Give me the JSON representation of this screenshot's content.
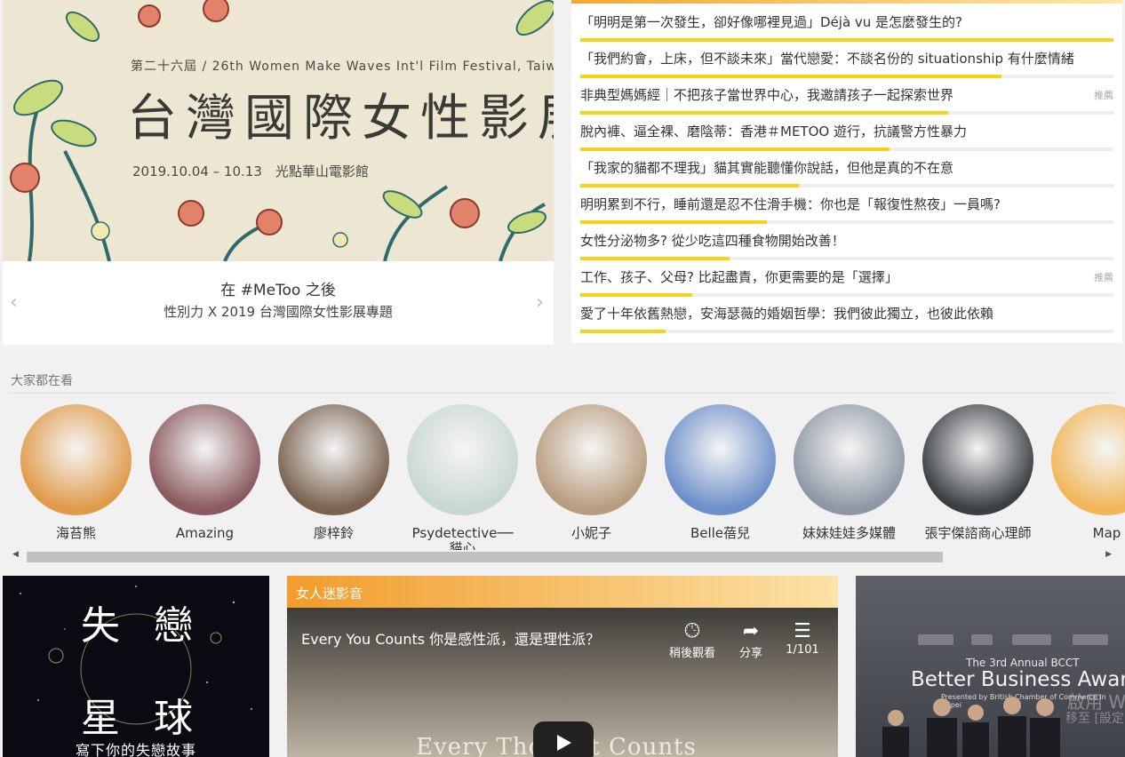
{
  "banner": {
    "subtitle": "第二十六屆 / 26th Women Make Waves Int'l Film Festival, Taiw",
    "title": "台灣國際女性影展",
    "date_venue": "2019.10.04 – 10.13　光點華山電影館",
    "caption_title": "在 #MeToo 之後",
    "caption_sub": "性別力 X 2019 台灣國際女性影展專題",
    "prev": "‹",
    "next": "›"
  },
  "articles": [
    {
      "title": "「明明是第一次發生，卻好像哪裡見過」Déjà vu 是怎麼發生的?",
      "tag": "",
      "progress": 1.0
    },
    {
      "title": "「我們約會，上床，但不談未來」當代戀愛：不談名份的 situationship 有什麼情緒",
      "tag": "",
      "progress": 0.79
    },
    {
      "title": "非典型媽媽經｜不把孩子當世界中心，我邀請孩子一起探索世界",
      "tag": "推薦",
      "progress": 0.69
    },
    {
      "title": "脫內褲、逼全裸、磨陰蒂：香港＃METOO 遊行，抗議警方性暴力",
      "tag": "",
      "progress": 0.58
    },
    {
      "title": "「我家的貓都不理我」貓其實能聽懂你說話，但他是真的不在意",
      "tag": "",
      "progress": 0.41
    },
    {
      "title": "明明累到不行，睡前還是忍不住滑手機：你也是「報復性熬夜」一員嗎?",
      "tag": "",
      "progress": 0.35
    },
    {
      "title": "女性分泌物多? 從少吃這四種食物開始改善！",
      "tag": "",
      "progress": 0.28
    },
    {
      "title": "工作、孩子、父母? 比起盡責，你更需要的是「選擇」",
      "tag": "推薦",
      "progress": 0.21
    },
    {
      "title": "愛了十年依舊熱戀，安海瑟薇的婚姻哲學：我們彼此獨立，也彼此依賴",
      "tag": "",
      "progress": 0.16
    }
  ],
  "everyone_watching": {
    "title": "大家都在看",
    "people": [
      {
        "name": "海苔熊",
        "color": "#e09a4a"
      },
      {
        "name": "Amazing",
        "color": "#8a5a5e"
      },
      {
        "name": "廖梓鈴",
        "color": "#7a6350"
      },
      {
        "name": "Psydetective──貓心",
        "color": "#c8d8d0"
      },
      {
        "name": "小妮子",
        "color": "#b89c7e"
      },
      {
        "name": "Belle蓓兒",
        "color": "#6d8fc9"
      },
      {
        "name": "妹妹娃娃多媒體",
        "color": "#8d98a5"
      },
      {
        "name": "張宇傑諮商心理師",
        "color": "#3a3f44"
      },
      {
        "name": "Map",
        "color": "#f1b65a"
      }
    ]
  },
  "cards": {
    "heartbreak": {
      "char1": "失",
      "char2": "戀",
      "char3": "星",
      "char4": "球",
      "cta": "寫下你的失戀故事"
    },
    "video": {
      "section": "女人迷影音",
      "title": "Every You Counts 你是感性派，還是理性派？",
      "watch_later": "稍後觀看",
      "share": "分享",
      "playlist": "1/101",
      "overlay": "Every  Thought  Counts"
    },
    "awards": {
      "line1": "The 3rd Annual BCCT",
      "line2": "Better Business Awards",
      "line3": "Presented by British Chamber of Commerce in Taipei",
      "watermark1": "啟用 Wi",
      "watermark2": "移至 [設定"
    }
  }
}
